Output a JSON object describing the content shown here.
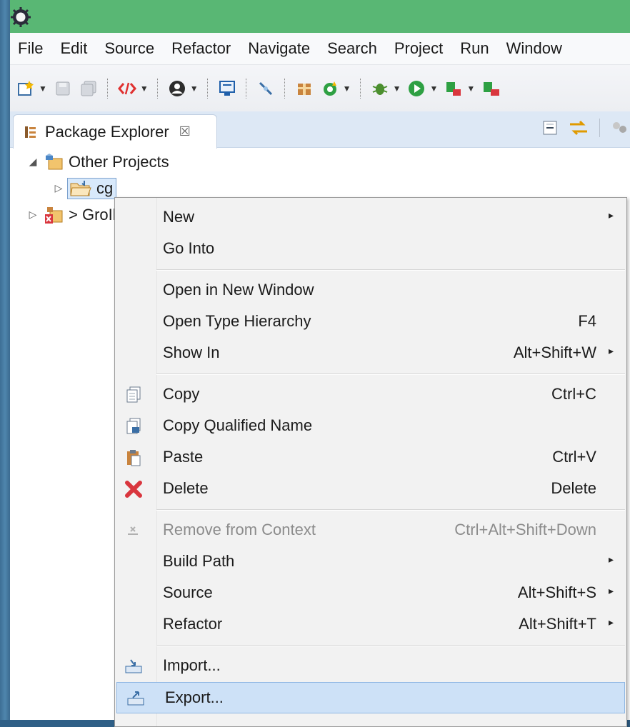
{
  "menubar": {
    "items": [
      "File",
      "Edit",
      "Source",
      "Refactor",
      "Navigate",
      "Search",
      "Project",
      "Run",
      "Window"
    ]
  },
  "toolbar": {
    "icons": [
      "new-wizard-icon",
      "save-icon",
      "save-all-icon",
      "code-icon",
      "profile-icon",
      "monitor-icon",
      "link-icon",
      "package-icon",
      "refresh-icon",
      "debug-icon",
      "run-icon",
      "run-external-icon",
      "server-icon"
    ]
  },
  "package_explorer": {
    "tab_label": "Package Explorer",
    "tab_close": "☒",
    "tree": [
      {
        "label": "Other Projects",
        "expanded": true
      },
      {
        "label": "cg",
        "selected": true
      },
      {
        "label": "> GroIl"
      }
    ]
  },
  "context_menu": {
    "items": [
      {
        "label": "New",
        "shortcut": "",
        "submenu": true,
        "icon": ""
      },
      {
        "label": "Go Into",
        "shortcut": "",
        "submenu": false,
        "icon": ""
      },
      {
        "label": "Open in New Window",
        "shortcut": "",
        "submenu": false,
        "icon": ""
      },
      {
        "label": "Open Type Hierarchy",
        "shortcut": "F4",
        "submenu": false,
        "icon": ""
      },
      {
        "label": "Show In",
        "shortcut": "Alt+Shift+W",
        "submenu": true,
        "icon": ""
      },
      {
        "label": "Copy",
        "shortcut": "Ctrl+C",
        "submenu": false,
        "icon": "copy-icon"
      },
      {
        "label": "Copy Qualified Name",
        "shortcut": "",
        "submenu": false,
        "icon": "copy-qualified-icon"
      },
      {
        "label": "Paste",
        "shortcut": "Ctrl+V",
        "submenu": false,
        "icon": "paste-icon"
      },
      {
        "label": "Delete",
        "shortcut": "Delete",
        "submenu": false,
        "icon": "delete-icon"
      },
      {
        "label": "Remove from Context",
        "shortcut": "Ctrl+Alt+Shift+Down",
        "submenu": false,
        "icon": "remove-context-icon",
        "disabled": true
      },
      {
        "label": "Build Path",
        "shortcut": "",
        "submenu": true,
        "icon": ""
      },
      {
        "label": "Source",
        "shortcut": "Alt+Shift+S",
        "submenu": true,
        "icon": ""
      },
      {
        "label": "Refactor",
        "shortcut": "Alt+Shift+T",
        "submenu": true,
        "icon": ""
      },
      {
        "label": "Import...",
        "shortcut": "",
        "submenu": false,
        "icon": "import-icon"
      },
      {
        "label": "Export...",
        "shortcut": "",
        "submenu": false,
        "icon": "export-icon",
        "highlighted": true
      }
    ],
    "submenu_arrow": "▸"
  },
  "colors": {
    "titlebar": "#59b774",
    "menu_highlight": "#cde1f7",
    "delete_red": "#d9363e",
    "run_green": "#2ea043"
  }
}
